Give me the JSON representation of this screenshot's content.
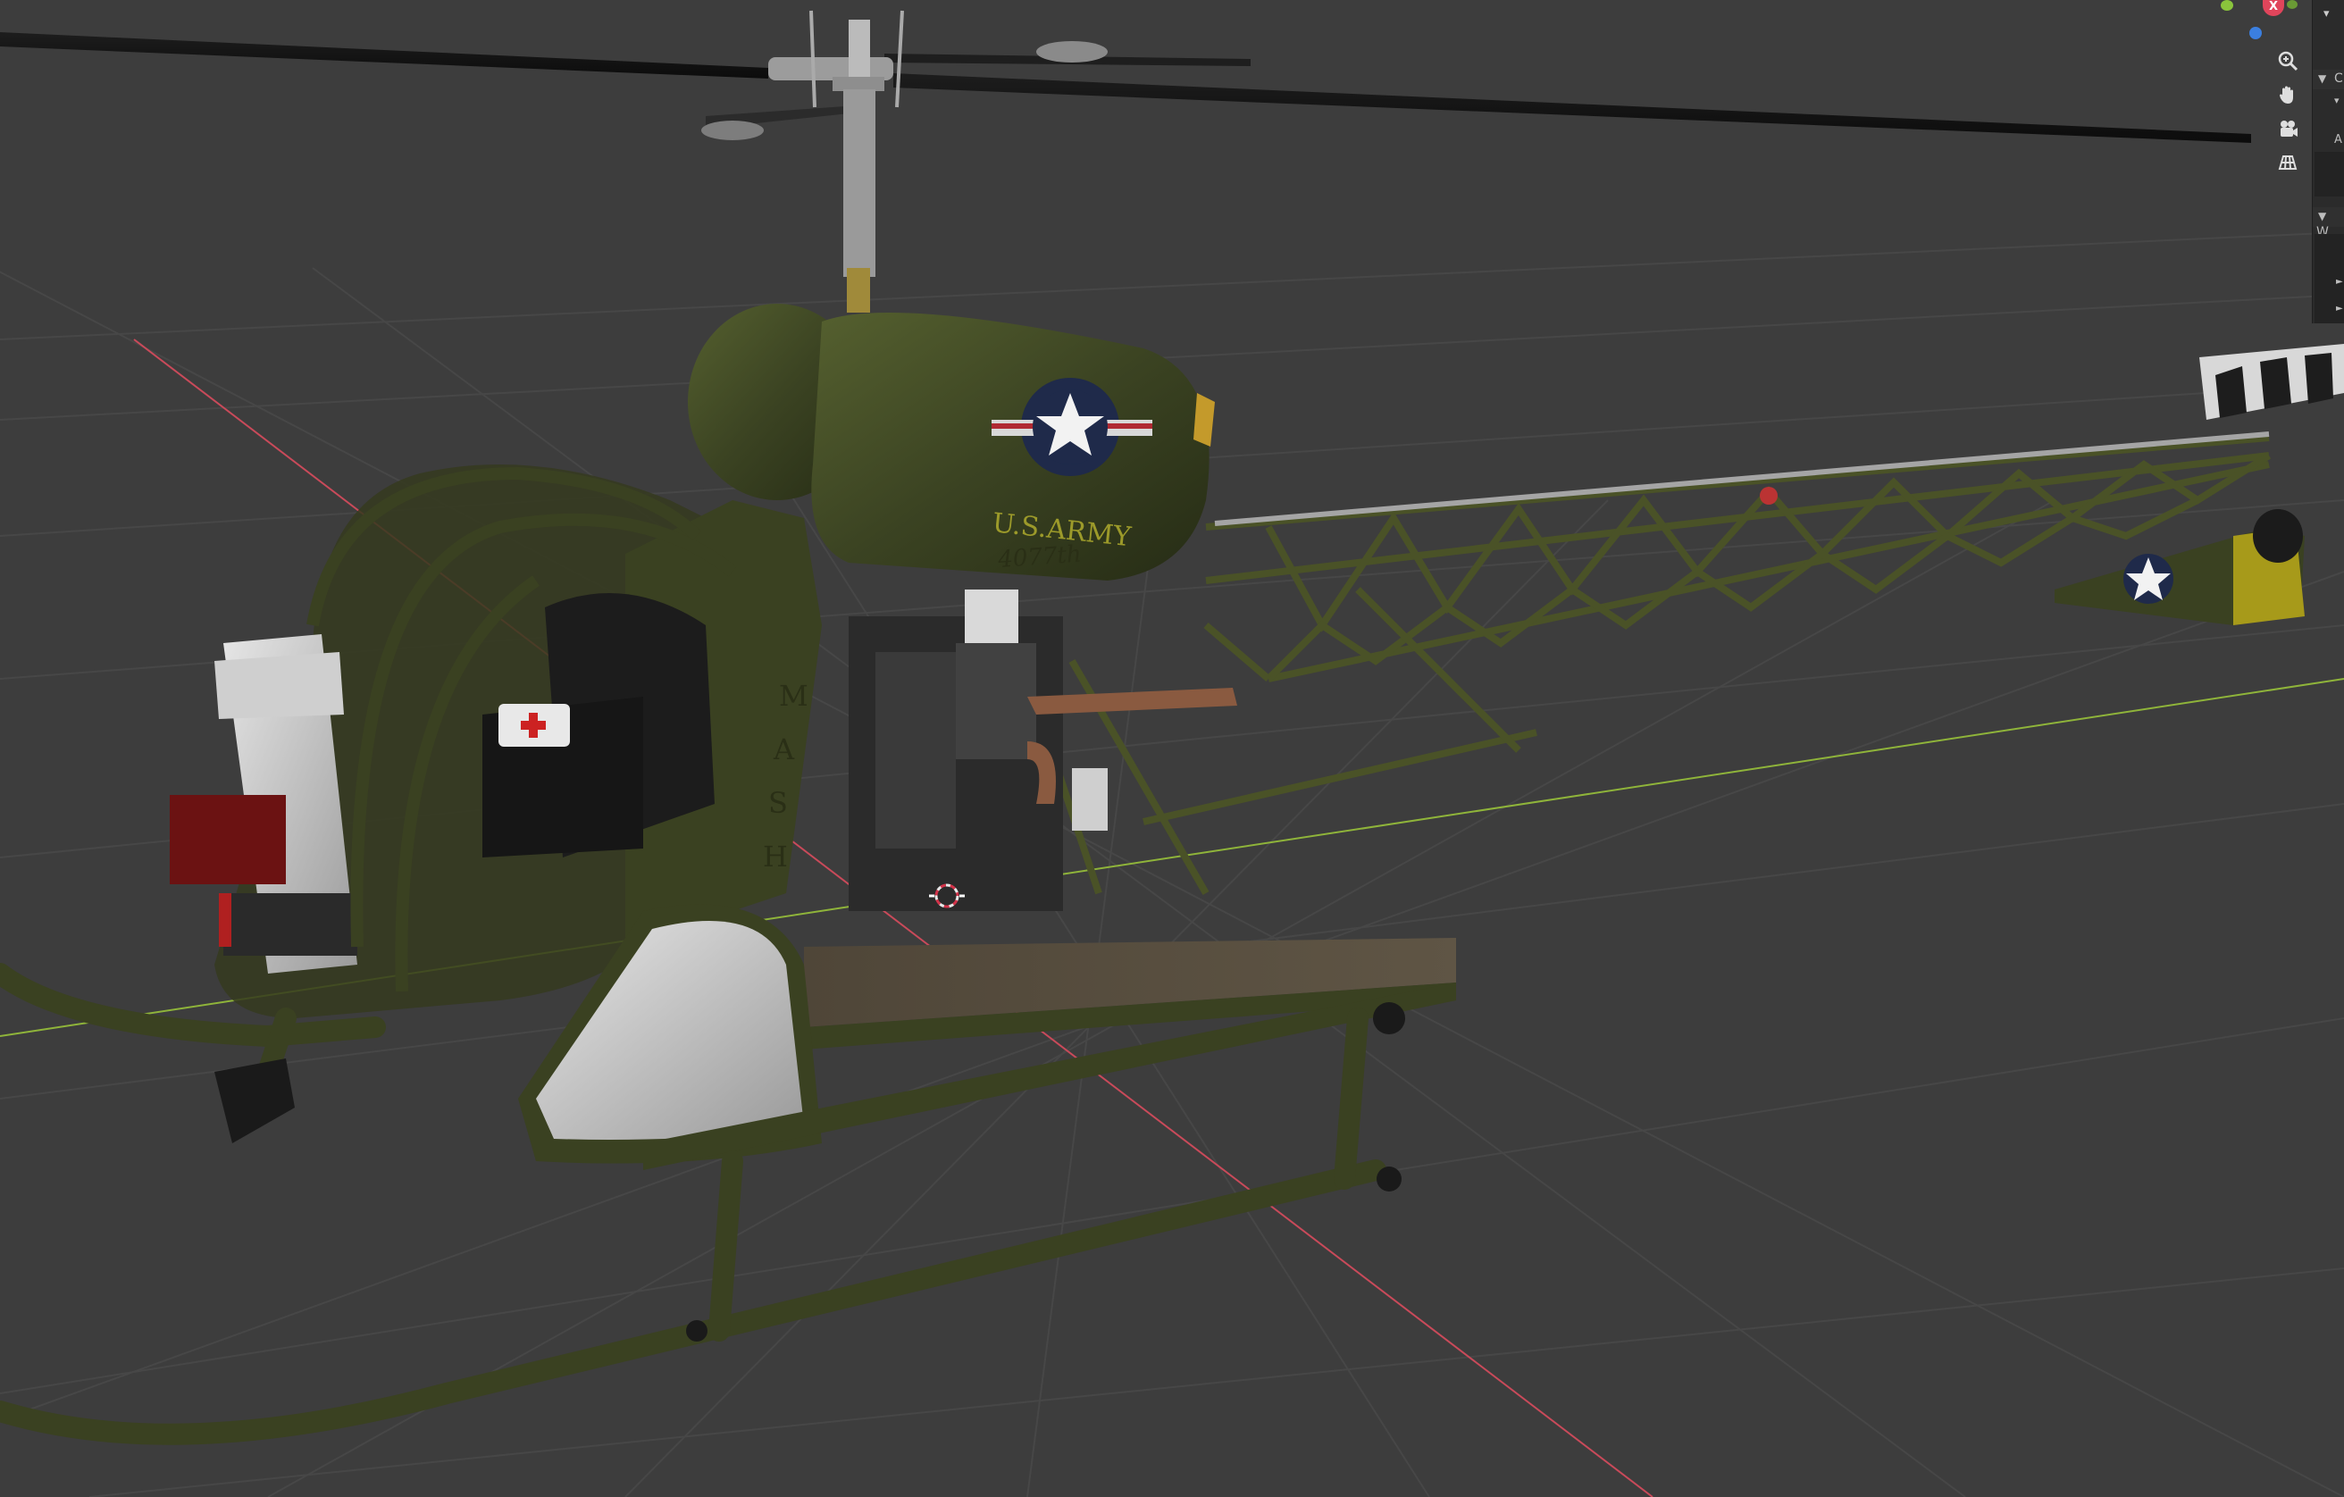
{
  "viewport": {
    "background": "#3d3d3d",
    "grid_color": "#484848",
    "x_axis_color": "#c94a5a",
    "y_axis_color": "#8fb43a",
    "model": {
      "body_color": "#3a4121",
      "tail_color": "#b3a81a",
      "insignia_text": "U.S.ARMY",
      "unit_text": "4077th",
      "side_letters": [
        "M",
        "A",
        "S",
        "H"
      ]
    }
  },
  "gizmo": {
    "x_label": "X",
    "x_color": "#e0455b",
    "y_color": "#8ac43c",
    "z_color": "#3b7fe0"
  },
  "nav_tools": [
    {
      "name": "zoom-icon"
    },
    {
      "name": "hand-pan-icon"
    },
    {
      "name": "camera-view-icon"
    },
    {
      "name": "ortho-grid-icon"
    }
  ],
  "sidebar": {
    "row_labels": [
      "C",
      "A",
      "W"
    ]
  }
}
